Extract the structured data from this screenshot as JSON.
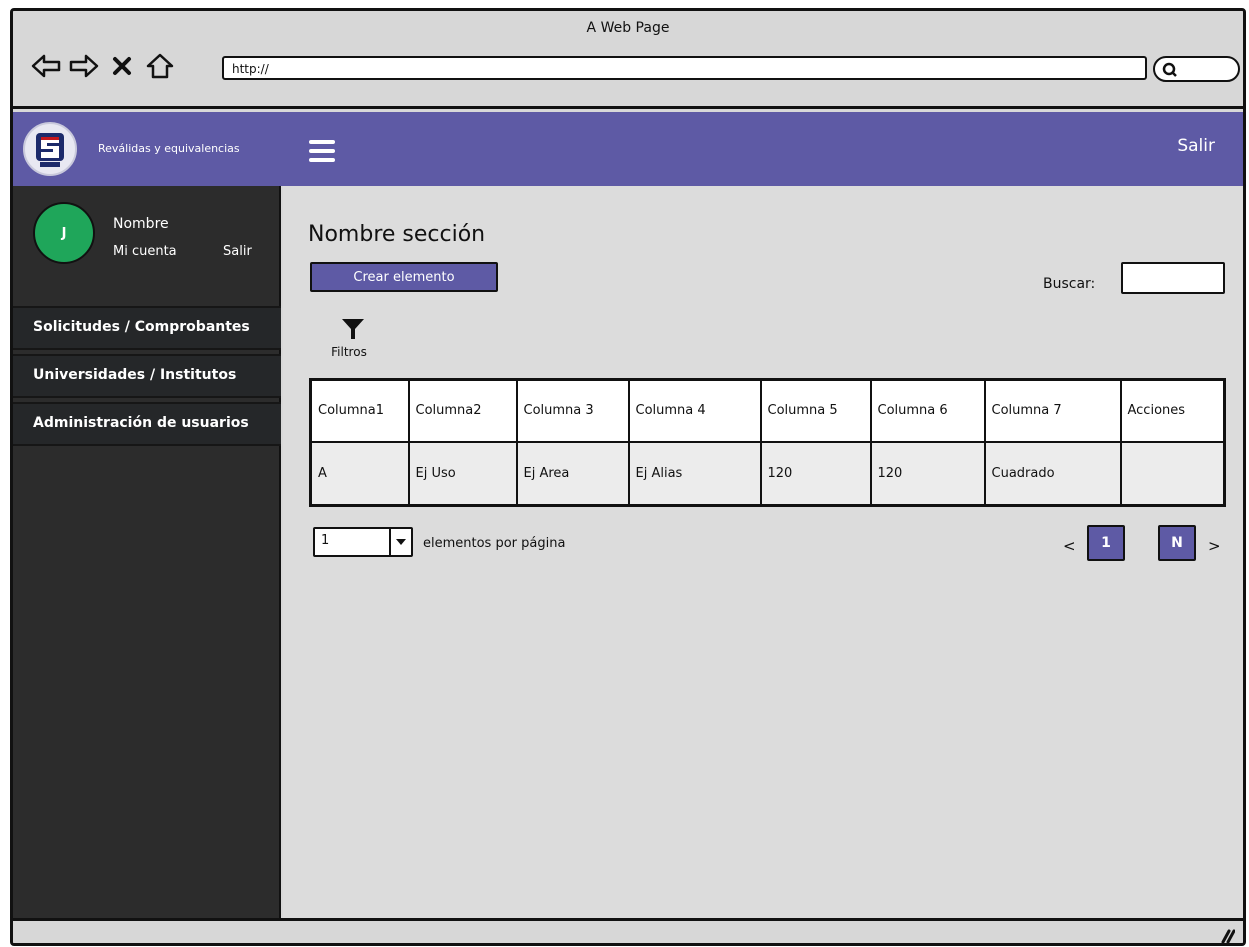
{
  "window": {
    "title": "A Web Page"
  },
  "address_bar": {
    "value": "http://"
  },
  "header": {
    "brand_name": "Reválidas y equivalencias",
    "logout_label": "Salir",
    "brand_color": "#5e5aa5"
  },
  "user": {
    "avatar_initial": "J",
    "name": "Nombre",
    "account_label": "Mi cuenta",
    "logout_label": "Salir"
  },
  "sidebar": {
    "items": [
      {
        "label": "Solicitudes / Comprobantes"
      },
      {
        "label": "Universidades / Institutos"
      },
      {
        "label": "Administración de usuarios"
      }
    ]
  },
  "main": {
    "section_title": "Nombre sección",
    "create_button": "Crear elemento",
    "search_label": "Buscar:",
    "filter_label": "Filtros",
    "table": {
      "columns": [
        "Columna1",
        "Columna2",
        "Columna 3",
        "Columna 4",
        "Columna 5",
        "Columna 6",
        "Columna 7",
        "Acciones"
      ],
      "rows": [
        [
          "A",
          "Ej Uso",
          "Ej Area",
          "Ej Alias",
          "120",
          "120",
          "Cuadrado",
          ""
        ]
      ]
    },
    "pagination": {
      "page_size_value": "1",
      "per_page_label": "elementos por página",
      "prev_label": "<",
      "pages": [
        "1",
        "N"
      ],
      "next_label": ">"
    }
  },
  "icons": {
    "back": "back-arrow-icon",
    "forward": "forward-arrow-icon",
    "stop": "close-icon",
    "home": "home-icon",
    "search": "search-icon",
    "menu": "hamburger-menu-icon",
    "filter": "filter-icon",
    "dropdown": "chevron-down-icon"
  }
}
